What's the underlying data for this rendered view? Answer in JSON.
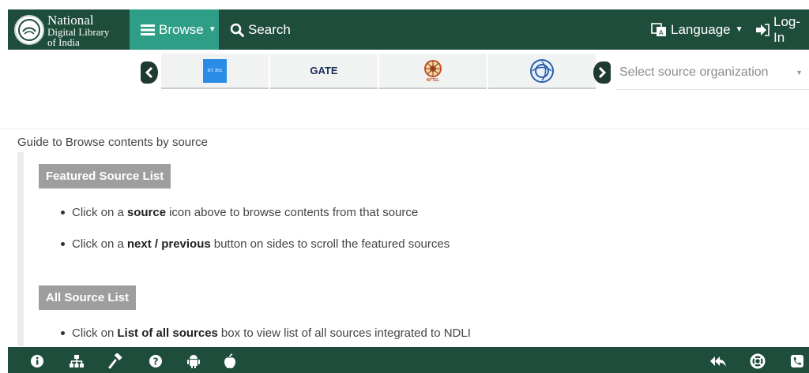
{
  "header": {
    "logo_line1": "National",
    "logo_line2": "Digital Library",
    "logo_line3": "of India",
    "browse_label": "Browse",
    "search_label": "Search",
    "language_label": "Language",
    "login_label": "Log-In"
  },
  "sources": {
    "tiles": [
      {
        "label": "IIT JEE",
        "icon": "iit-jee-logo"
      },
      {
        "label": "GATE",
        "icon": "gate-logo"
      },
      {
        "label": "NPTEL",
        "icon": "nptel-logo"
      },
      {
        "label": "",
        "icon": "circular-emblem-logo"
      }
    ],
    "select_placeholder": "Select source organization"
  },
  "guide": {
    "title": "Guide to Browse contents by source",
    "featured": {
      "heading": "Featured Source List",
      "bullets": [
        {
          "pre": "Click on a",
          "bold": "source",
          "post": "icon above to browse contents from that source"
        },
        {
          "pre": "Click on a",
          "bold": "next / previous",
          "post": "button on sides to scroll the featured sources"
        }
      ]
    },
    "all": {
      "heading": "All Source List",
      "bullets": [
        {
          "pre": "Click on",
          "bold": "List of all sources",
          "post": "box to view list of all sources integrated to NDLI"
        }
      ]
    }
  },
  "footer": {
    "icons_left": [
      "info-icon",
      "sitemap-icon",
      "gavel-icon",
      "help-icon",
      "android-icon",
      "apple-icon"
    ],
    "icons_right": [
      "reply-all-icon",
      "lifebuoy-icon",
      "phone-icon"
    ]
  },
  "colors": {
    "nav_bg": "#1f4d3b",
    "browse_bg": "#2f9e86",
    "section_label_bg": "#9e9e9e"
  }
}
